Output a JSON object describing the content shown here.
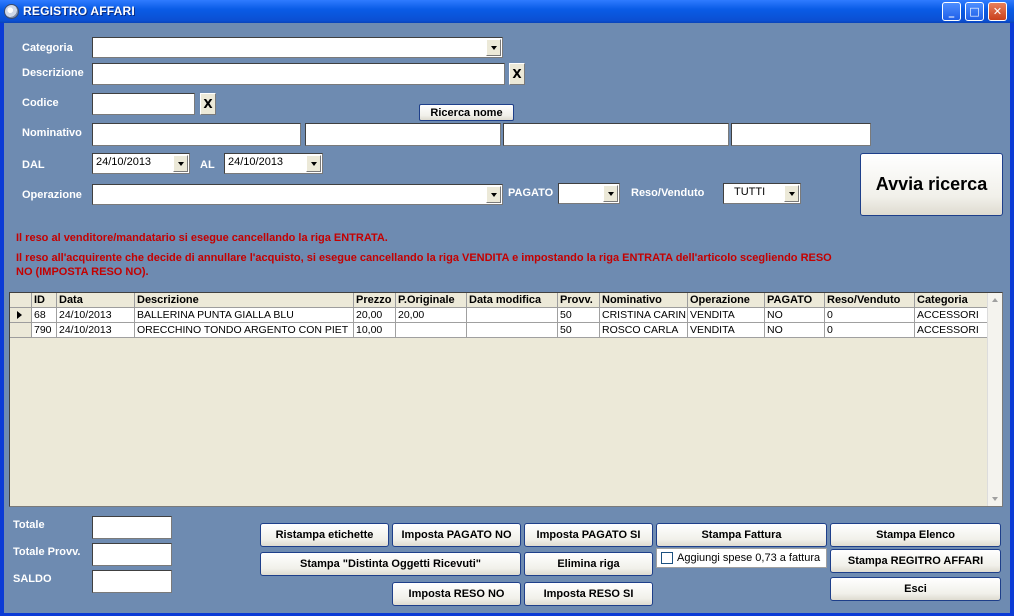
{
  "window": {
    "title": "REGISTRO AFFARI",
    "minimize": "_",
    "maximize": "□",
    "close": "✕"
  },
  "labels": {
    "categoria": "Categoria",
    "descrizione": "Descrizione",
    "codice": "Codice",
    "nominativo": "Nominativo",
    "dal": "DAL",
    "al": "AL",
    "operazione": "Operazione",
    "pagato": "PAGATO",
    "reso_venduto": "Reso/Venduto",
    "totale": "Totale",
    "totale_provv": "Totale Provv.",
    "saldo": "SALDO"
  },
  "filters": {
    "categoria": "",
    "descrizione": "",
    "codice": "",
    "nominativo": [
      "",
      "",
      "",
      ""
    ],
    "dal": "24/10/2013",
    "al": "24/10/2013",
    "operazione": "",
    "pagato": "",
    "reso_venduto": "TUTTI",
    "clear": "X"
  },
  "notes": {
    "line1": "Il reso al venditore/mandatario si esegue cancellando la riga ENTRATA.",
    "line2": "Il reso all'acquirente che decide di annullare l'acquisto, si esegue cancellando la riga VENDITA e impostando la riga ENTRATA dell'articolo scegliendo RESO",
    "line3": "NO (IMPOSTA RESO NO)."
  },
  "buttons": {
    "ricerca_nome": "Ricerca nome",
    "avvia_ricerca": "Avvia ricerca",
    "ristampa_etichette": "Ristampa etichette",
    "imposta_pagato_no": "Imposta PAGATO NO",
    "imposta_pagato_si": "Imposta PAGATO SI",
    "stampa_fattura": "Stampa Fattura",
    "stampa_elenco": "Stampa Elenco",
    "stampa_distinta": "Stampa \"Distinta Oggetti Ricevuti\"",
    "elimina_riga": "Elimina riga",
    "stampa_registro": "Stampa REGITRO AFFARI",
    "imposta_reso_no": "Imposta RESO NO",
    "imposta_reso_si": "Imposta RESO SI",
    "esci": "Esci"
  },
  "checkbox": {
    "aggiungi_spese": "Aggiungi spese 0,73 a fattura",
    "checked": false
  },
  "totals": {
    "totale": "",
    "totale_provv": "",
    "saldo": ""
  },
  "table": {
    "columns": [
      "ID",
      "Data",
      "Descrizione",
      "Prezzo",
      "P.Originale",
      "Data modifica",
      "Provv.",
      "Nominativo",
      "Operazione",
      "PAGATO",
      "Reso/Venduto",
      "Categoria"
    ],
    "rows": [
      [
        "68",
        "24/10/2013",
        "BALLERINA PUNTA GIALLA BLU",
        "20,00",
        "20,00",
        "",
        "50",
        "CRISTINA CARIN",
        "VENDITA",
        "NO",
        "0",
        "ACCESSORI"
      ],
      [
        "790",
        "24/10/2013",
        "ORECCHINO TONDO ARGENTO CON PIET",
        "10,00",
        "",
        "",
        "50",
        "ROSCO CARLA",
        "VENDITA",
        "NO",
        "0",
        "ACCESSORI"
      ]
    ]
  }
}
